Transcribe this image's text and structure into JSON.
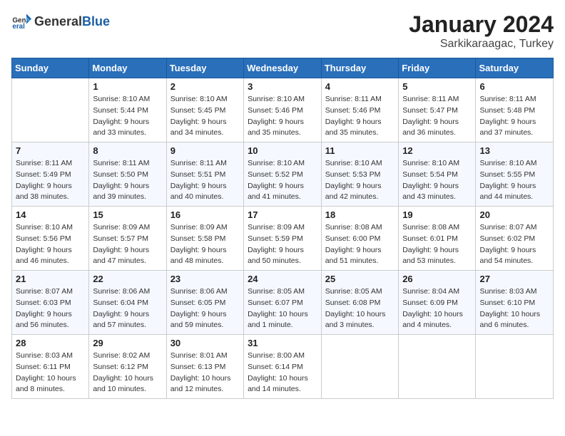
{
  "header": {
    "logo_general": "General",
    "logo_blue": "Blue",
    "month_title": "January 2024",
    "location": "Sarkikaraagac, Turkey"
  },
  "calendar": {
    "days_of_week": [
      "Sunday",
      "Monday",
      "Tuesday",
      "Wednesday",
      "Thursday",
      "Friday",
      "Saturday"
    ],
    "weeks": [
      [
        {
          "day": "",
          "sunrise": "",
          "sunset": "",
          "daylight": ""
        },
        {
          "day": "1",
          "sunrise": "8:10 AM",
          "sunset": "5:44 PM",
          "daylight": "9 hours and 33 minutes."
        },
        {
          "day": "2",
          "sunrise": "8:10 AM",
          "sunset": "5:45 PM",
          "daylight": "9 hours and 34 minutes."
        },
        {
          "day": "3",
          "sunrise": "8:10 AM",
          "sunset": "5:46 PM",
          "daylight": "9 hours and 35 minutes."
        },
        {
          "day": "4",
          "sunrise": "8:11 AM",
          "sunset": "5:46 PM",
          "daylight": "9 hours and 35 minutes."
        },
        {
          "day": "5",
          "sunrise": "8:11 AM",
          "sunset": "5:47 PM",
          "daylight": "9 hours and 36 minutes."
        },
        {
          "day": "6",
          "sunrise": "8:11 AM",
          "sunset": "5:48 PM",
          "daylight": "9 hours and 37 minutes."
        }
      ],
      [
        {
          "day": "7",
          "sunrise": "8:11 AM",
          "sunset": "5:49 PM",
          "daylight": "9 hours and 38 minutes."
        },
        {
          "day": "8",
          "sunrise": "8:11 AM",
          "sunset": "5:50 PM",
          "daylight": "9 hours and 39 minutes."
        },
        {
          "day": "9",
          "sunrise": "8:11 AM",
          "sunset": "5:51 PM",
          "daylight": "9 hours and 40 minutes."
        },
        {
          "day": "10",
          "sunrise": "8:10 AM",
          "sunset": "5:52 PM",
          "daylight": "9 hours and 41 minutes."
        },
        {
          "day": "11",
          "sunrise": "8:10 AM",
          "sunset": "5:53 PM",
          "daylight": "9 hours and 42 minutes."
        },
        {
          "day": "12",
          "sunrise": "8:10 AM",
          "sunset": "5:54 PM",
          "daylight": "9 hours and 43 minutes."
        },
        {
          "day": "13",
          "sunrise": "8:10 AM",
          "sunset": "5:55 PM",
          "daylight": "9 hours and 44 minutes."
        }
      ],
      [
        {
          "day": "14",
          "sunrise": "8:10 AM",
          "sunset": "5:56 PM",
          "daylight": "9 hours and 46 minutes."
        },
        {
          "day": "15",
          "sunrise": "8:09 AM",
          "sunset": "5:57 PM",
          "daylight": "9 hours and 47 minutes."
        },
        {
          "day": "16",
          "sunrise": "8:09 AM",
          "sunset": "5:58 PM",
          "daylight": "9 hours and 48 minutes."
        },
        {
          "day": "17",
          "sunrise": "8:09 AM",
          "sunset": "5:59 PM",
          "daylight": "9 hours and 50 minutes."
        },
        {
          "day": "18",
          "sunrise": "8:08 AM",
          "sunset": "6:00 PM",
          "daylight": "9 hours and 51 minutes."
        },
        {
          "day": "19",
          "sunrise": "8:08 AM",
          "sunset": "6:01 PM",
          "daylight": "9 hours and 53 minutes."
        },
        {
          "day": "20",
          "sunrise": "8:07 AM",
          "sunset": "6:02 PM",
          "daylight": "9 hours and 54 minutes."
        }
      ],
      [
        {
          "day": "21",
          "sunrise": "8:07 AM",
          "sunset": "6:03 PM",
          "daylight": "9 hours and 56 minutes."
        },
        {
          "day": "22",
          "sunrise": "8:06 AM",
          "sunset": "6:04 PM",
          "daylight": "9 hours and 57 minutes."
        },
        {
          "day": "23",
          "sunrise": "8:06 AM",
          "sunset": "6:05 PM",
          "daylight": "9 hours and 59 minutes."
        },
        {
          "day": "24",
          "sunrise": "8:05 AM",
          "sunset": "6:07 PM",
          "daylight": "10 hours and 1 minute."
        },
        {
          "day": "25",
          "sunrise": "8:05 AM",
          "sunset": "6:08 PM",
          "daylight": "10 hours and 3 minutes."
        },
        {
          "day": "26",
          "sunrise": "8:04 AM",
          "sunset": "6:09 PM",
          "daylight": "10 hours and 4 minutes."
        },
        {
          "day": "27",
          "sunrise": "8:03 AM",
          "sunset": "6:10 PM",
          "daylight": "10 hours and 6 minutes."
        }
      ],
      [
        {
          "day": "28",
          "sunrise": "8:03 AM",
          "sunset": "6:11 PM",
          "daylight": "10 hours and 8 minutes."
        },
        {
          "day": "29",
          "sunrise": "8:02 AM",
          "sunset": "6:12 PM",
          "daylight": "10 hours and 10 minutes."
        },
        {
          "day": "30",
          "sunrise": "8:01 AM",
          "sunset": "6:13 PM",
          "daylight": "10 hours and 12 minutes."
        },
        {
          "day": "31",
          "sunrise": "8:00 AM",
          "sunset": "6:14 PM",
          "daylight": "10 hours and 14 minutes."
        },
        {
          "day": "",
          "sunrise": "",
          "sunset": "",
          "daylight": ""
        },
        {
          "day": "",
          "sunrise": "",
          "sunset": "",
          "daylight": ""
        },
        {
          "day": "",
          "sunrise": "",
          "sunset": "",
          "daylight": ""
        }
      ]
    ]
  }
}
